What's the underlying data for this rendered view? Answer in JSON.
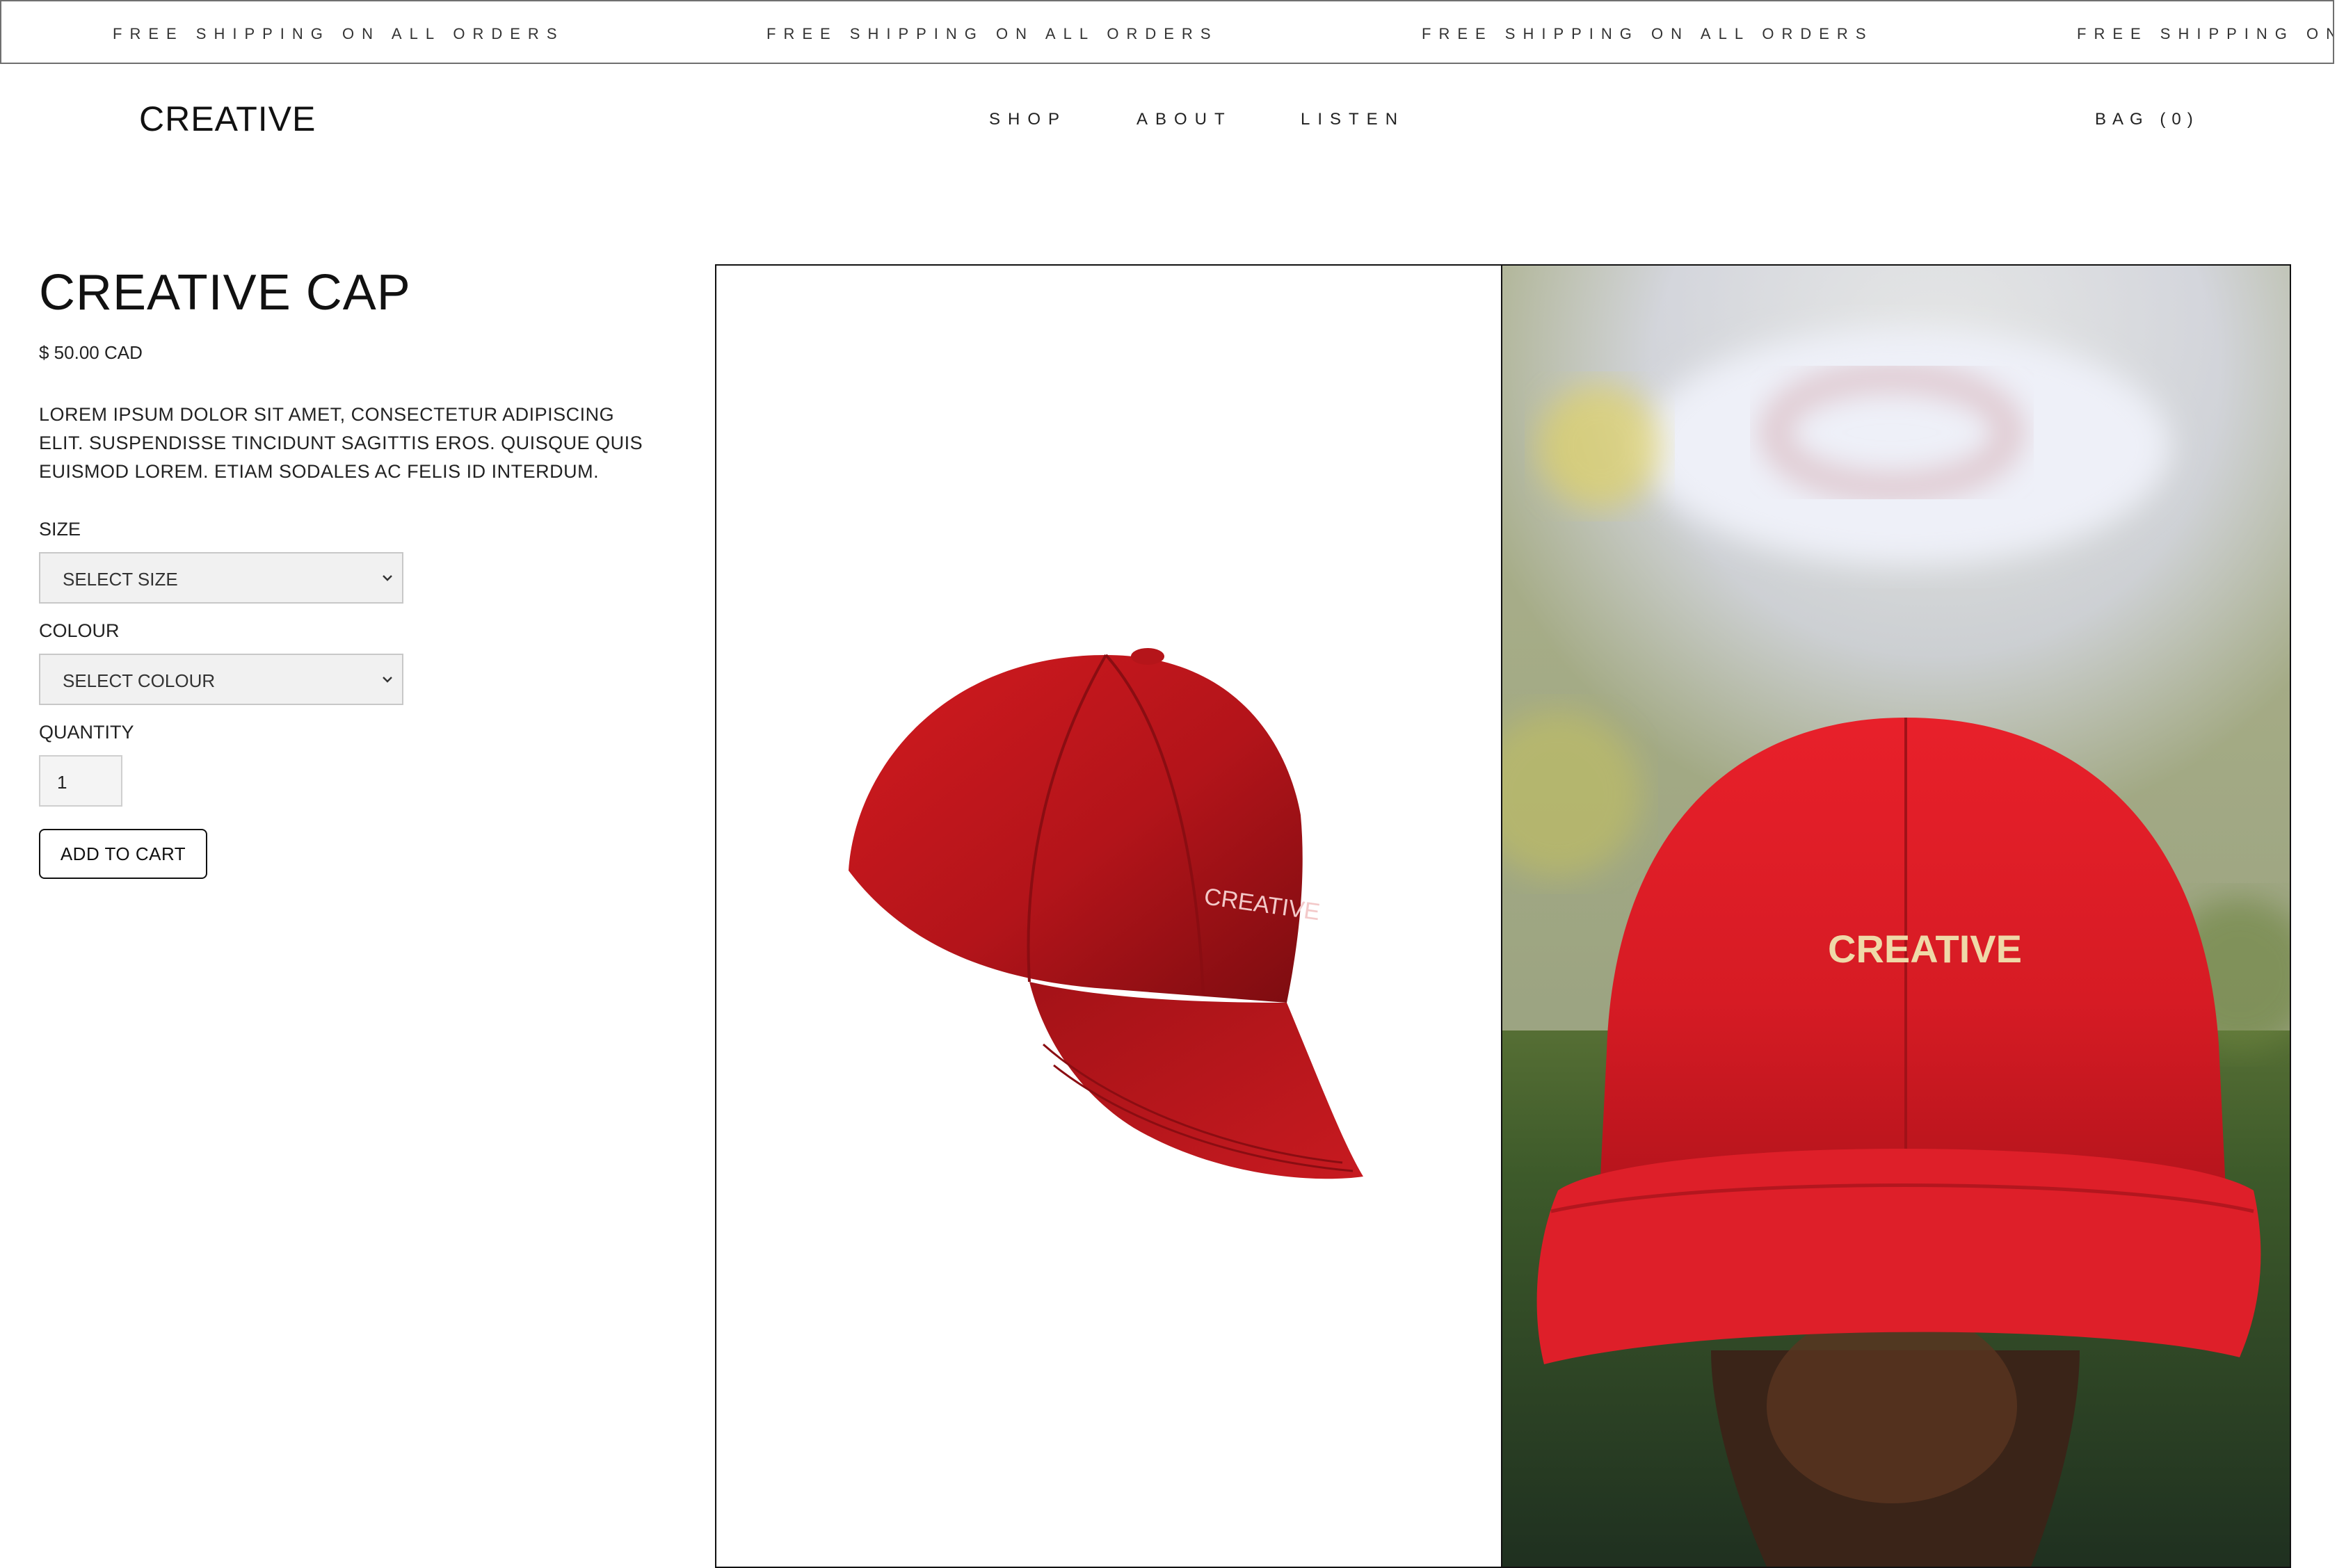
{
  "announcement": {
    "text": "FREE SHIPPING ON ALL ORDERS",
    "repeat": [
      "FREE SHIPPING ON ALL ORDERS",
      "FREE SHIPPING ON ALL ORDERS",
      "FREE SHIPPING ON ALL ORDERS",
      "FREE SHIPPING ON"
    ]
  },
  "header": {
    "logo": "CREATIVE",
    "nav": [
      "SHOP",
      "ABOUT",
      "LISTEN"
    ],
    "bag": "BAG (0)"
  },
  "product": {
    "title": "CREATIVE CAP",
    "price": "$ 50.00 CAD",
    "description": "LOREM IPSUM DOLOR SIT AMET, CONSECTETUR ADIPISCING ELIT. SUSPENDISSE TINCIDUNT SAGITTIS EROS. QUISQUE QUIS EUISMOD LOREM. ETIAM SODALES AC FELIS ID INTERDUM.",
    "size_label": "SIZE",
    "size_value": "SELECT SIZE",
    "colour_label": "COLOUR",
    "colour_value": "SELECT COLOUR",
    "quantity_label": "QUANTITY",
    "quantity_value": "1",
    "add_to_cart": "ADD TO CART"
  },
  "gallery": {
    "cap_text_left": "CREATIVE",
    "cap_text_right": "CREATIVE",
    "cap_color": "#c8151b",
    "icons": [
      "chevron-down-icon",
      "chevron-down-icon"
    ]
  }
}
